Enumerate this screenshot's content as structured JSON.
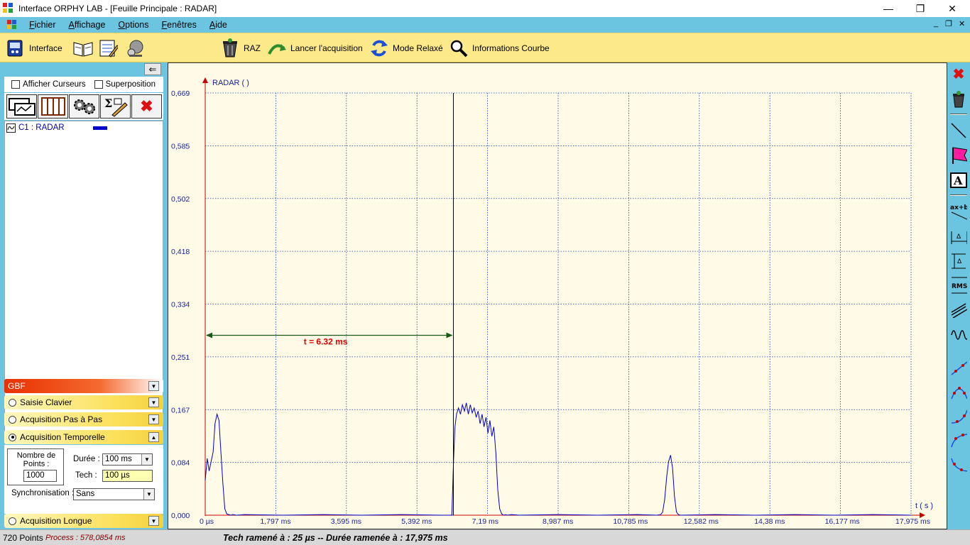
{
  "window": {
    "title": "Interface ORPHY LAB - [Feuille Principale :  RADAR]",
    "minimize_glyph": "—",
    "maximize_glyph": "❐",
    "close_glyph": "✕"
  },
  "menubar": {
    "items": [
      "Fichier",
      "Affichage",
      "Options",
      "Fenêtres",
      "Aide"
    ],
    "mdi_minimize": "_",
    "mdi_restore": "❐",
    "mdi_close": "✕"
  },
  "toolbar": {
    "interface_label": "Interface",
    "raz_label": "RAZ",
    "lancer_label": "Lancer l'acquisition",
    "mode_label": "Mode Relaxé",
    "info_label": "Informations Courbe"
  },
  "left_panel": {
    "afficher_curseurs": "Afficher Curseurs",
    "superposition": "Superposition",
    "curve_item": "C1 : RADAR",
    "curve_color": "#0000cc",
    "sections": {
      "gbf": "GBF",
      "saisie": "Saisie Clavier",
      "pas_a_pas": "Acquisition Pas à  Pas",
      "temporelle": "Acquisition Temporelle",
      "longue": "Acquisition Longue"
    },
    "acquisition": {
      "nombre_points_label": "Nombre de Points :",
      "nombre_points_value": "1000",
      "duree_label": "Durée :",
      "duree_value": "100 ms",
      "tech_label": "Tech :",
      "tech_value": "100 µs",
      "sync_label": "Synchronisation :",
      "sync_value": "Sans"
    }
  },
  "chart_data": {
    "type": "line",
    "title": "RADAR (  )",
    "xlabel": "t ( s )",
    "ylabel": "",
    "xlim": [
      0,
      17.975
    ],
    "ylim": [
      0,
      0.669
    ],
    "x_tick_labels": [
      "0 µs",
      "1,797 ms",
      "3,595 ms",
      "5,392 ms",
      "7,19 ms",
      "8,987 ms",
      "10,785 ms",
      "12,582 ms",
      "14,38 ms",
      "16,177 ms",
      "17,975 ms"
    ],
    "y_tick_labels": [
      "0,000",
      "0,084",
      "0,167",
      "0,251",
      "0,334",
      "0,418",
      "0,502",
      "0,585",
      "0,669"
    ],
    "grid": true,
    "line_color": "#0000cc",
    "cursor": {
      "x_ms": 6.32,
      "label": "t = 6.32 ms",
      "arrow_y": 0.285,
      "label_color": "#dd0000"
    },
    "series": [
      {
        "x": [
          0,
          0.05,
          0.1,
          0.15,
          0.2,
          0.25,
          0.3,
          0.35,
          0.4,
          0.45,
          0.5,
          0.55,
          0.6,
          0.65,
          0.7,
          0.8,
          1.0,
          2.0,
          3.0,
          4.0,
          5.0,
          6.0,
          6.28,
          6.32,
          6.36,
          6.4,
          6.45,
          6.5,
          6.55,
          6.6,
          6.65,
          6.7,
          6.75,
          6.8,
          6.85,
          6.9,
          6.95,
          7.0,
          7.05,
          7.1,
          7.15,
          7.2,
          7.25,
          7.3,
          7.35,
          7.4,
          7.45,
          7.5,
          7.55,
          7.6,
          7.65,
          7.7,
          7.8,
          8.0,
          9.0,
          10.0,
          11.0,
          11.5,
          11.6,
          11.65,
          11.7,
          11.75,
          11.8,
          11.85,
          11.9,
          11.95,
          12.0,
          12.05,
          12.1,
          13.0,
          14.0,
          15.0,
          16.0,
          17.0,
          17.975
        ],
        "y": [
          0.055,
          0.09,
          0.07,
          0.085,
          0.1,
          0.145,
          0.16,
          0.15,
          0.1,
          0.05,
          0.01,
          0.002,
          0.001,
          0.0,
          0.001,
          0.0,
          0.001,
          0.0,
          0.001,
          0.0,
          0.001,
          0.0,
          0.0,
          0.08,
          0.14,
          0.16,
          0.17,
          0.16,
          0.175,
          0.165,
          0.178,
          0.16,
          0.175,
          0.162,
          0.17,
          0.155,
          0.165,
          0.145,
          0.16,
          0.14,
          0.155,
          0.13,
          0.15,
          0.125,
          0.14,
          0.1,
          0.04,
          0.01,
          0.002,
          0.0,
          0.001,
          0.0,
          0.001,
          0.0,
          0.001,
          0.0,
          0.001,
          0.0,
          0.001,
          0.005,
          0.025,
          0.06,
          0.085,
          0.095,
          0.075,
          0.03,
          0.005,
          0.001,
          0.0,
          0.001,
          0.0,
          0.001,
          0.0,
          0.001,
          0.0
        ]
      }
    ]
  },
  "status": {
    "points": "720 Points",
    "process": "Process : 578,0854 ms",
    "tech": "Tech ramené à : 25 µs -- Durée ramenée à : 17,975 ms"
  }
}
